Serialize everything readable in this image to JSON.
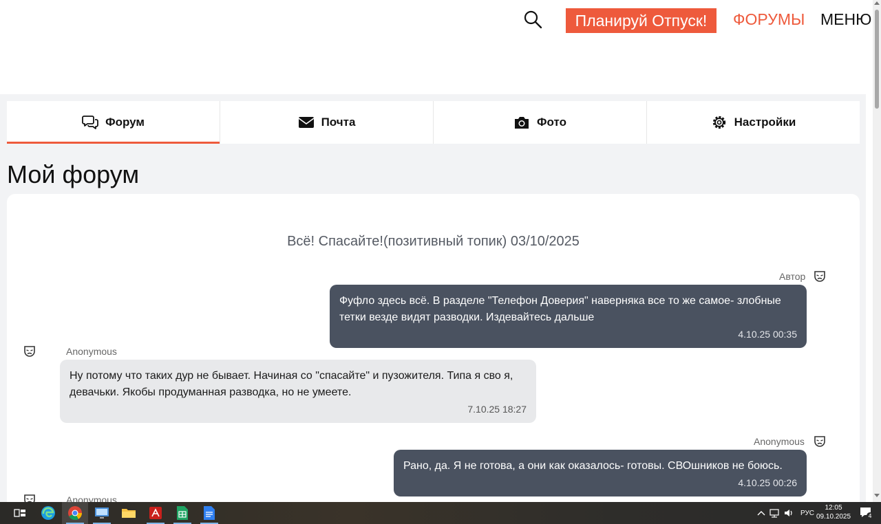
{
  "header": {
    "plan_button": "Планируй Отпуск!",
    "forums_link": "ФОРУМЫ",
    "menu_link": "МЕНЮ",
    "search_icon": "search-icon",
    "accent_color": "#ee5a3c"
  },
  "tabs": [
    {
      "label": "Форум",
      "icon": "chat-bubbles-icon",
      "active": true
    },
    {
      "label": "Почта",
      "icon": "envelope-icon",
      "active": false
    },
    {
      "label": "Фото",
      "icon": "camera-icon",
      "active": false
    },
    {
      "label": "Настройки",
      "icon": "gear-icon",
      "active": false
    }
  ],
  "page_title": "Мой форум",
  "topic": {
    "title": "Всё! Спасайте!(позитивный топик) 03/10/2025"
  },
  "messages": [
    {
      "author": "Автор",
      "text": "Фуфло здесь всё. В разделе \"Телефон Доверия\" наверняка все то же самое- злобные тетки везде видят разводки. Издевайтесь дальше",
      "time": "4.10.25 00:35",
      "style": "dark"
    },
    {
      "author": "Anonymous",
      "text": "Ну потому что таких дур не бывает. Начиная со \"спасайте\" и пузожителя. Типа я сво я, девачьки. Якобы продуманная разводка, но не умеете.",
      "time": "7.10.25 18:27",
      "style": "light"
    },
    {
      "author": "Anonymous",
      "text": "Рано, да. Я не готова, а они как оказалось- готовы. СВОшников не боюсь.",
      "time": "4.10.25 00:26",
      "style": "dark"
    },
    {
      "author": "Anonymous",
      "text": "",
      "time": "",
      "style": "light"
    }
  ],
  "taskbar": {
    "apps": [
      "task-view-icon",
      "edge-icon",
      "chrome-icon",
      "remote-desktop-icon",
      "file-explorer-icon",
      "acrobat-icon",
      "spreadsheet-icon",
      "document-icon"
    ],
    "language": "РУС",
    "time": "12:05",
    "date": "09.10.2025",
    "notifications": "4"
  }
}
